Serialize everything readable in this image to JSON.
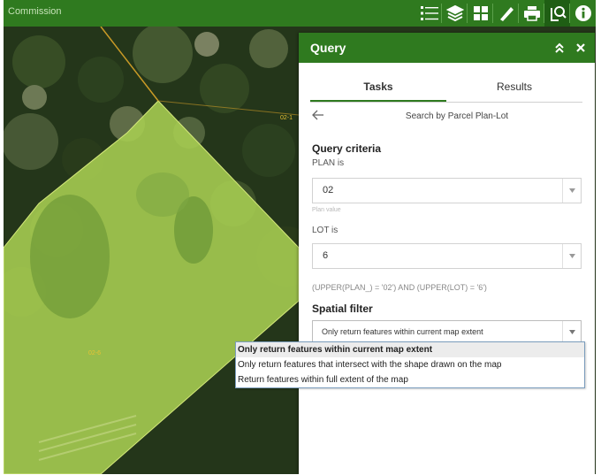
{
  "app": {
    "title": "Commission"
  },
  "toolbar": {
    "icons": [
      "legend-icon",
      "layers-icon",
      "basemap-gallery-icon",
      "measurement-icon",
      "print-icon",
      "query-icon",
      "about-icon"
    ]
  },
  "map": {
    "parcel_labels": [
      "02-1",
      "02-6"
    ],
    "colors": {
      "parcel_fill": "#a8cf52",
      "boundary": "#c99a26",
      "label": "#e9c233"
    }
  },
  "panel": {
    "title": "Query",
    "tabs": [
      {
        "label": "Tasks",
        "active": true
      },
      {
        "label": "Results",
        "active": false
      }
    ],
    "search_title": "Search by Parcel Plan-Lot",
    "query_criteria": {
      "heading": "Query criteria",
      "plan": {
        "label": "PLAN is",
        "value": "02",
        "hint": "Plan value"
      },
      "lot": {
        "label": "LOT is",
        "value": "6"
      },
      "expression": "(UPPER(PLAN_) = '02') AND (UPPER(LOT) = '6')"
    },
    "spatial_filter": {
      "heading": "Spatial filter",
      "selected": "Only return features within current map extent",
      "options": [
        "Only return features within current map extent",
        "Only return features that intersect with the shape drawn on the map",
        "Return features within full extent of the map"
      ]
    }
  },
  "colors": {
    "header": "#2f7a1f",
    "active_tab_underline": "#2f7a1f"
  }
}
